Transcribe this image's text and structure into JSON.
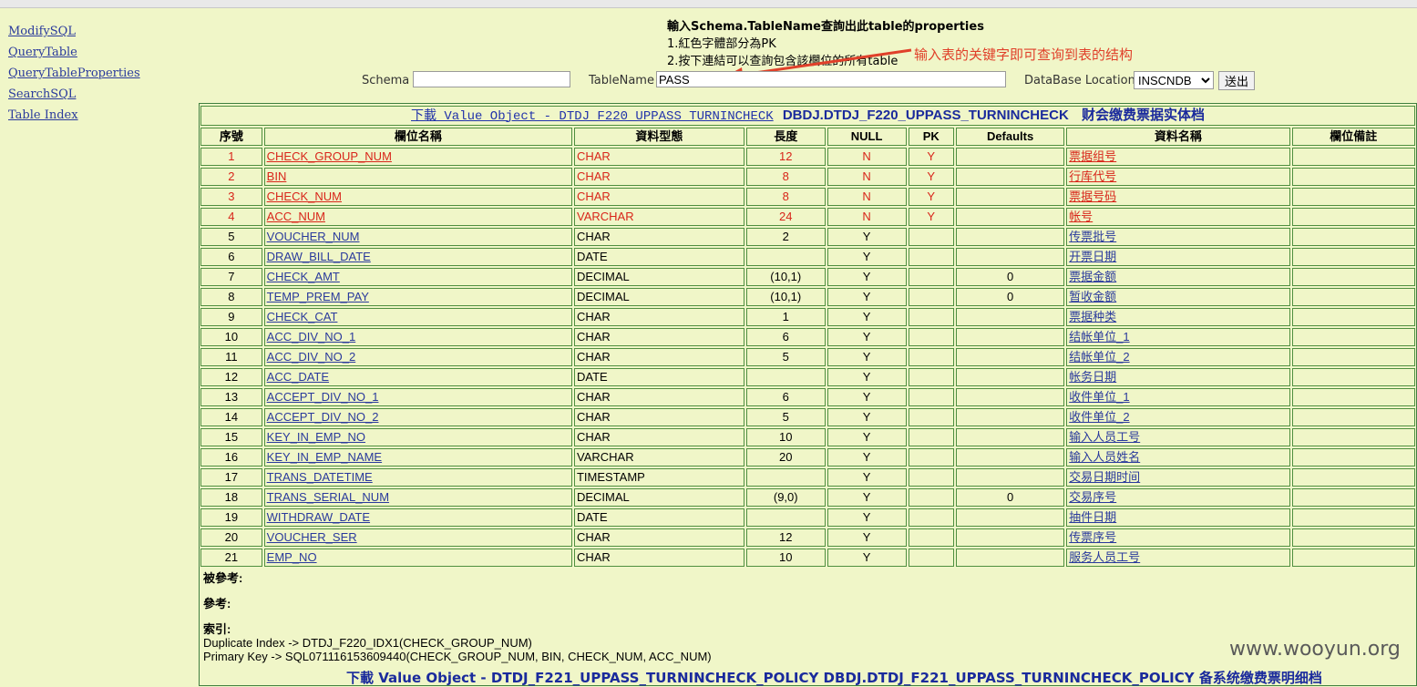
{
  "nav": {
    "items": [
      "ModifySQL",
      "QueryTable",
      "QueryTableProperties",
      "SearchSQL",
      "Table Index"
    ]
  },
  "instructions": {
    "title": "輸入Schema.TableName查詢出此table的properties",
    "line1": "1.紅色字體部分為PK",
    "line2": "2.按下連結可以查詢包含該欄位的所有table"
  },
  "callout": "输入表的关键字即可查询到表的结构",
  "form": {
    "schema_label": "Schema :",
    "schema_value": "",
    "tablename_label": "TableName :",
    "tablename_value": "PASS",
    "db_label": "DataBase Location :",
    "db_selected": "INSCNDB",
    "submit_label": "送出"
  },
  "table": {
    "download_link": "下載 Value Object - DTDJ_F220_UPPASS_TURNINCHECK",
    "table_name": "DBDJ.DTDJ_F220_UPPASS_TURNINCHECK",
    "table_desc": "财会缴费票据实体档",
    "headers": [
      "序號",
      "欄位名稱",
      "資料型態",
      "長度",
      "NULL",
      "PK",
      "Defaults",
      "資料名稱",
      "欄位備註"
    ],
    "rows": [
      {
        "no": "1",
        "name": "CHECK_GROUP_NUM",
        "type": "CHAR",
        "len": "12",
        "null": "N",
        "pk": "Y",
        "def": "",
        "desc": "票据组号",
        "note": "",
        "is_pk": true
      },
      {
        "no": "2",
        "name": "BIN",
        "type": "CHAR",
        "len": "8",
        "null": "N",
        "pk": "Y",
        "def": "",
        "desc": "行库代号",
        "note": "",
        "is_pk": true
      },
      {
        "no": "3",
        "name": "CHECK_NUM",
        "type": "CHAR",
        "len": "8",
        "null": "N",
        "pk": "Y",
        "def": "",
        "desc": "票据号码",
        "note": "",
        "is_pk": true
      },
      {
        "no": "4",
        "name": "ACC_NUM",
        "type": "VARCHAR",
        "len": "24",
        "null": "N",
        "pk": "Y",
        "def": "",
        "desc": "帐号",
        "note": "",
        "is_pk": true
      },
      {
        "no": "5",
        "name": "VOUCHER_NUM",
        "type": "CHAR",
        "len": "2",
        "null": "Y",
        "pk": "",
        "def": "",
        "desc": "传票批号",
        "note": "",
        "is_pk": false
      },
      {
        "no": "6",
        "name": "DRAW_BILL_DATE",
        "type": "DATE",
        "len": "",
        "null": "Y",
        "pk": "",
        "def": "",
        "desc": "开票日期",
        "note": "",
        "is_pk": false
      },
      {
        "no": "7",
        "name": "CHECK_AMT",
        "type": "DECIMAL",
        "len": "(10,1)",
        "null": "Y",
        "pk": "",
        "def": "0",
        "desc": "票据金额",
        "note": "",
        "is_pk": false
      },
      {
        "no": "8",
        "name": "TEMP_PREM_PAY",
        "type": "DECIMAL",
        "len": "(10,1)",
        "null": "Y",
        "pk": "",
        "def": "0",
        "desc": "暂收金额",
        "note": "",
        "is_pk": false
      },
      {
        "no": "9",
        "name": "CHECK_CAT",
        "type": "CHAR",
        "len": "1",
        "null": "Y",
        "pk": "",
        "def": "",
        "desc": "票据种类",
        "note": "",
        "is_pk": false
      },
      {
        "no": "10",
        "name": "ACC_DIV_NO_1",
        "type": "CHAR",
        "len": "6",
        "null": "Y",
        "pk": "",
        "def": "",
        "desc": "结帐单位_1",
        "note": "",
        "is_pk": false
      },
      {
        "no": "11",
        "name": "ACC_DIV_NO_2",
        "type": "CHAR",
        "len": "5",
        "null": "Y",
        "pk": "",
        "def": "",
        "desc": "结帐单位_2",
        "note": "",
        "is_pk": false
      },
      {
        "no": "12",
        "name": "ACC_DATE",
        "type": "DATE",
        "len": "",
        "null": "Y",
        "pk": "",
        "def": "",
        "desc": "帐务日期",
        "note": "",
        "is_pk": false
      },
      {
        "no": "13",
        "name": "ACCEPT_DIV_NO_1",
        "type": "CHAR",
        "len": "6",
        "null": "Y",
        "pk": "",
        "def": "",
        "desc": "收件单位_1",
        "note": "",
        "is_pk": false
      },
      {
        "no": "14",
        "name": "ACCEPT_DIV_NO_2",
        "type": "CHAR",
        "len": "5",
        "null": "Y",
        "pk": "",
        "def": "",
        "desc": "收件单位_2",
        "note": "",
        "is_pk": false
      },
      {
        "no": "15",
        "name": "KEY_IN_EMP_NO",
        "type": "CHAR",
        "len": "10",
        "null": "Y",
        "pk": "",
        "def": "",
        "desc": "输入人员工号",
        "note": "",
        "is_pk": false
      },
      {
        "no": "16",
        "name": "KEY_IN_EMP_NAME",
        "type": "VARCHAR",
        "len": "20",
        "null": "Y",
        "pk": "",
        "def": "",
        "desc": "输入人员姓名",
        "note": "",
        "is_pk": false
      },
      {
        "no": "17",
        "name": "TRANS_DATETIME",
        "type": "TIMESTAMP",
        "len": "",
        "null": "Y",
        "pk": "",
        "def": "",
        "desc": "交易日期时间",
        "note": "",
        "is_pk": false
      },
      {
        "no": "18",
        "name": "TRANS_SERIAL_NUM",
        "type": "DECIMAL",
        "len": "(9,0)",
        "null": "Y",
        "pk": "",
        "def": "0",
        "desc": "交易序号",
        "note": "",
        "is_pk": false
      },
      {
        "no": "19",
        "name": "WITHDRAW_DATE",
        "type": "DATE",
        "len": "",
        "null": "Y",
        "pk": "",
        "def": "",
        "desc": "抽件日期",
        "note": "",
        "is_pk": false
      },
      {
        "no": "20",
        "name": "VOUCHER_SER",
        "type": "CHAR",
        "len": "12",
        "null": "Y",
        "pk": "",
        "def": "",
        "desc": "传票序号",
        "note": "",
        "is_pk": false
      },
      {
        "no": "21",
        "name": "EMP_NO",
        "type": "CHAR",
        "len": "10",
        "null": "Y",
        "pk": "",
        "def": "",
        "desc": "服务人员工号",
        "note": "",
        "is_pk": false
      }
    ],
    "referenced_by_label": "被參考:",
    "references_label": "參考:",
    "index_label": "索引:",
    "index_lines": [
      "Duplicate Index -> DTDJ_F220_IDX1(CHECK_GROUP_NUM)",
      "Primary Key -> SQL071116153609440(CHECK_GROUP_NUM, BIN, CHECK_NUM, ACC_NUM)"
    ]
  },
  "next_table_caption": "下載 Value Object - DTDJ_F221_UPPASS_TURNINCHECK_POLICY  DBDJ.DTDJ_F221_UPPASS_TURNINCHECK_POLICY  备系统缴费票明细档",
  "watermark": "www.wooyun.org",
  "colors": {
    "background": "#f0f6c8",
    "pk_text": "#d8251a",
    "link": "#2a3a9c",
    "callout": "#e0402a"
  }
}
